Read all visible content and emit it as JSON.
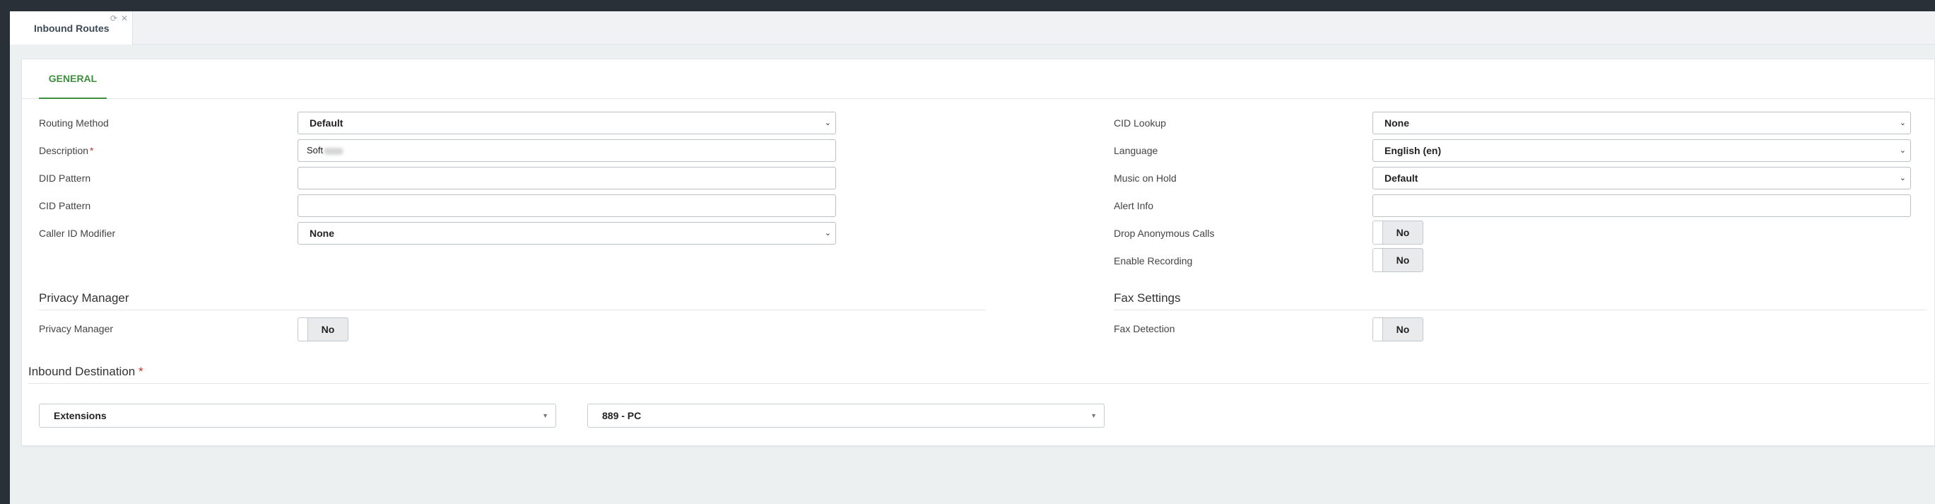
{
  "app_tab": {
    "label": "Inbound Routes",
    "refresh_icon": "refresh-icon",
    "close_icon": "close-icon"
  },
  "card": {
    "tab_general": "GENERAL"
  },
  "left": {
    "routing_method": {
      "label": "Routing Method",
      "value": "Default"
    },
    "description": {
      "label": "Description",
      "required": "*",
      "value": "Soft"
    },
    "did_pattern": {
      "label": "DID Pattern",
      "value": ""
    },
    "cid_pattern": {
      "label": "CID Pattern",
      "value": ""
    },
    "caller_id_modifier": {
      "label": "Caller ID Modifier",
      "value": "None"
    }
  },
  "right": {
    "cid_lookup": {
      "label": "CID Lookup",
      "value": "None"
    },
    "language": {
      "label": "Language",
      "value": "English (en)"
    },
    "music_on_hold": {
      "label": "Music on Hold",
      "value": "Default"
    },
    "alert_info": {
      "label": "Alert Info",
      "value": ""
    },
    "drop_anonymous_calls": {
      "label": "Drop Anonymous Calls",
      "value": "No"
    },
    "enable_recording": {
      "label": "Enable Recording",
      "value": "No"
    }
  },
  "privacy": {
    "title": "Privacy Manager",
    "label": "Privacy Manager",
    "value": "No"
  },
  "fax": {
    "title": "Fax Settings",
    "label": "Fax Detection",
    "value": "No"
  },
  "destination": {
    "title": "Inbound Destination",
    "required": "*",
    "type_value": "Extensions",
    "target_value": "889 - PC"
  },
  "colors": {
    "accent": "#3e8f3e",
    "required": "#c0392b",
    "background": "#edf0f1"
  }
}
